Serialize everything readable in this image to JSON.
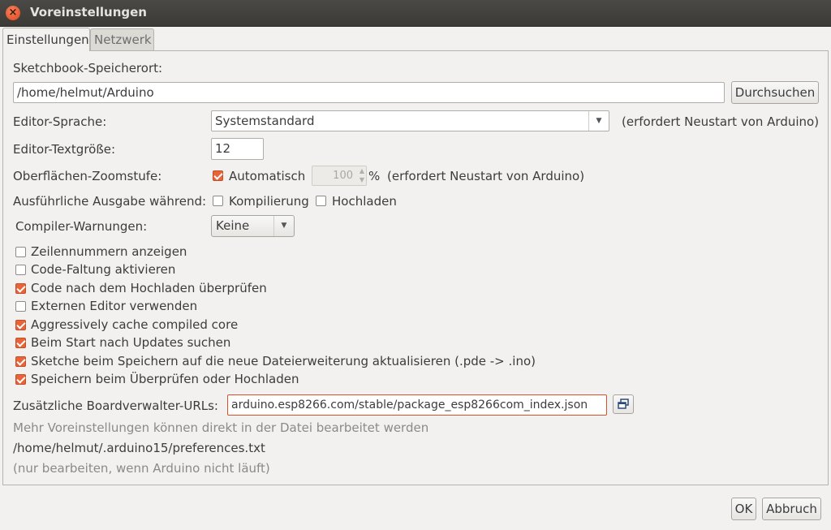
{
  "window": {
    "title": "Voreinstellungen"
  },
  "tabs": [
    {
      "label": "Einstellungen",
      "active": true
    },
    {
      "label": "Netzwerk",
      "active": false
    }
  ],
  "sketchbook": {
    "label": "Sketchbook-Speicherort:",
    "value": "/home/helmut/Arduino",
    "browse_label": "Durchsuchen"
  },
  "editor_language": {
    "label": "Editor-Sprache:",
    "value": "Systemstandard",
    "note": "(erfordert Neustart von Arduino)"
  },
  "editor_font_size": {
    "label": "Editor-Textgröße:",
    "value": "12"
  },
  "zoom": {
    "label": "Oberflächen-Zoomstufe:",
    "auto_label": "Automatisch",
    "auto_checked": true,
    "value": "100",
    "unit": "%",
    "note": "(erfordert Neustart von Arduino)"
  },
  "verbose": {
    "label": "Ausführliche Ausgabe während:",
    "compile_label": "Kompilierung",
    "compile_checked": false,
    "upload_label": "Hochladen",
    "upload_checked": false
  },
  "compiler_warnings": {
    "label": "Compiler-Warnungen:",
    "value": "Keine"
  },
  "options": [
    {
      "label": "Zeilennummern anzeigen",
      "checked": false
    },
    {
      "label": "Code-Faltung aktivieren",
      "checked": false
    },
    {
      "label": "Code nach dem Hochladen überprüfen",
      "checked": true
    },
    {
      "label": "Externen Editor verwenden",
      "checked": false
    },
    {
      "label": "Aggressively cache compiled core",
      "checked": true
    },
    {
      "label": "Beim Start nach Updates suchen",
      "checked": true
    },
    {
      "label": "Sketche beim Speichern auf die neue Dateierweiterung aktualisieren (.pde -> .ino)",
      "checked": true
    },
    {
      "label": "Speichern beim Überprüfen oder Hochladen",
      "checked": true
    }
  ],
  "board_urls": {
    "label": "Zusätzliche Boardverwalter-URLs:",
    "value": "arduino.esp8266.com/stable/package_esp8266com_index.json",
    "button_icon": "window-open-icon"
  },
  "info": {
    "more_text": "Mehr Voreinstellungen können direkt in der Datei bearbeitet werden",
    "path": "/home/helmut/.arduino15/preferences.txt",
    "hint": "(nur bearbeiten, wenn Arduino nicht läuft)"
  },
  "footer": {
    "ok_label": "OK",
    "cancel_label": "Abbruch"
  },
  "colors": {
    "accent": "#e8643a",
    "titlebar": "#3b3a37",
    "background": "#f2f1f0"
  }
}
